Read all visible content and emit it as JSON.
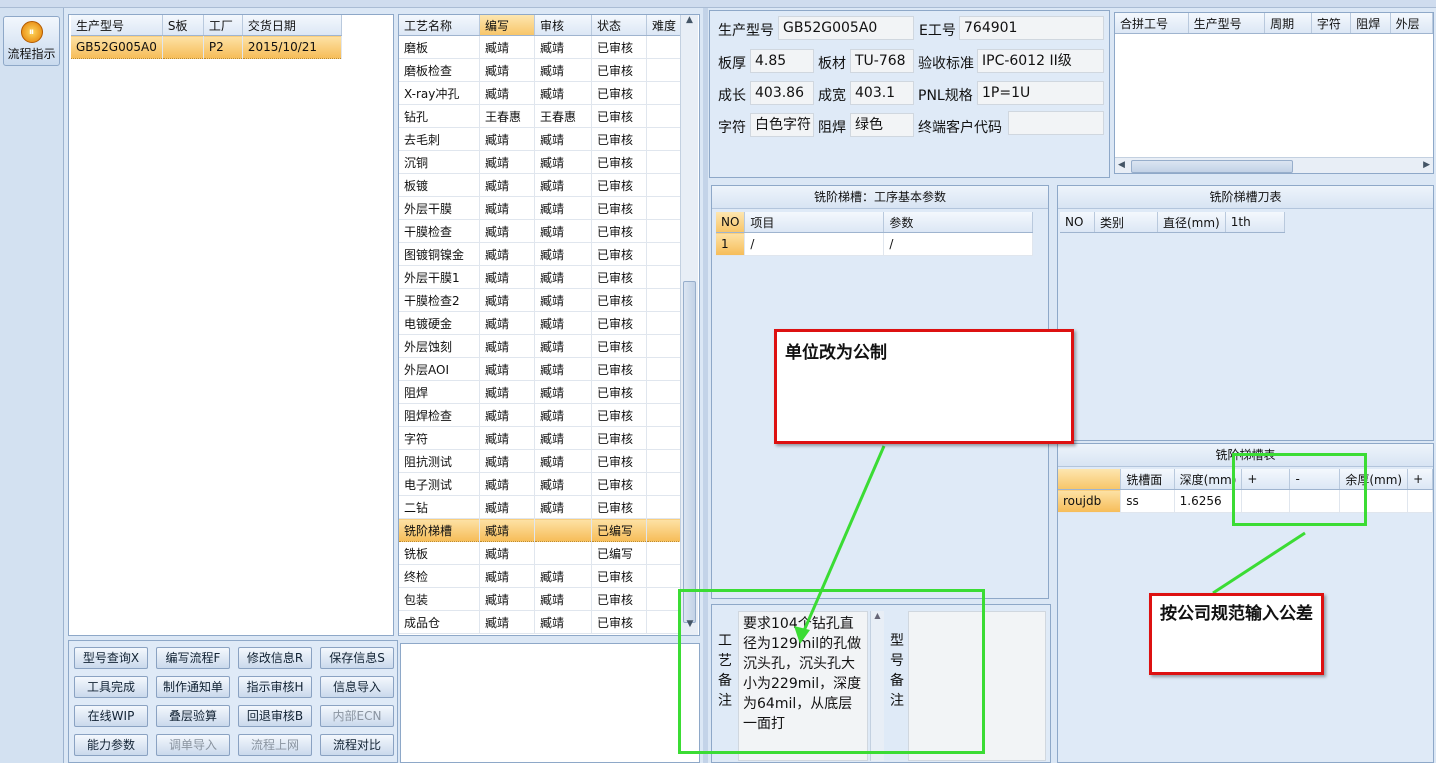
{
  "left_nav": {
    "flow_button_label": "流程指示"
  },
  "model_list": {
    "columns": [
      "生产型号",
      "S板",
      "工厂",
      "交货日期"
    ],
    "rows": [
      [
        "GB52G005A0",
        "",
        "P2",
        "2015/10/21"
      ]
    ]
  },
  "process_grid": {
    "columns": [
      "工艺名称",
      "编写",
      "审核",
      "状态",
      "难度"
    ],
    "rows": [
      [
        "磨板",
        "臧靖",
        "臧靖",
        "已审核",
        ""
      ],
      [
        "磨板检查",
        "臧靖",
        "臧靖",
        "已审核",
        ""
      ],
      [
        "X-ray冲孔",
        "臧靖",
        "臧靖",
        "已审核",
        ""
      ],
      [
        "钻孔",
        "王春惠",
        "王春惠",
        "已审核",
        ""
      ],
      [
        "去毛刺",
        "臧靖",
        "臧靖",
        "已审核",
        ""
      ],
      [
        "沉铜",
        "臧靖",
        "臧靖",
        "已审核",
        ""
      ],
      [
        "板镀",
        "臧靖",
        "臧靖",
        "已审核",
        ""
      ],
      [
        "外层干膜",
        "臧靖",
        "臧靖",
        "已审核",
        ""
      ],
      [
        "干膜检查",
        "臧靖",
        "臧靖",
        "已审核",
        ""
      ],
      [
        "图镀铜镍金",
        "臧靖",
        "臧靖",
        "已审核",
        ""
      ],
      [
        "外层干膜1",
        "臧靖",
        "臧靖",
        "已审核",
        ""
      ],
      [
        "干膜检查2",
        "臧靖",
        "臧靖",
        "已审核",
        ""
      ],
      [
        "电镀硬金",
        "臧靖",
        "臧靖",
        "已审核",
        ""
      ],
      [
        "外层蚀刻",
        "臧靖",
        "臧靖",
        "已审核",
        ""
      ],
      [
        "外层AOI",
        "臧靖",
        "臧靖",
        "已审核",
        ""
      ],
      [
        "阻焊",
        "臧靖",
        "臧靖",
        "已审核",
        ""
      ],
      [
        "阻焊检查",
        "臧靖",
        "臧靖",
        "已审核",
        ""
      ],
      [
        "字符",
        "臧靖",
        "臧靖",
        "已审核",
        ""
      ],
      [
        "阻抗测试",
        "臧靖",
        "臧靖",
        "已审核",
        ""
      ],
      [
        "电子测试",
        "臧靖",
        "臧靖",
        "已审核",
        ""
      ],
      [
        "二钻",
        "臧靖",
        "臧靖",
        "已审核",
        ""
      ],
      [
        "铣阶梯槽",
        "臧靖",
        "",
        "已编写",
        ""
      ],
      [
        "铣板",
        "臧靖",
        "",
        "已编写",
        ""
      ],
      [
        "终检",
        "臧靖",
        "臧靖",
        "已审核",
        ""
      ],
      [
        "包装",
        "臧靖",
        "臧靖",
        "已审核",
        ""
      ],
      [
        "成品仓",
        "臧靖",
        "臧靖",
        "已审核",
        ""
      ]
    ],
    "selected_index": 21
  },
  "buttons": [
    [
      "型号查询X",
      "编写流程F",
      "修改信息R",
      "保存信息S"
    ],
    [
      "工具完成",
      "制作通知单",
      "指示审核H",
      "信息导入"
    ],
    [
      "在线WIP",
      "叠层验算",
      "回退审核B",
      "内部ECN"
    ],
    [
      "能力参数",
      "调单导入",
      "流程上网",
      "流程对比"
    ]
  ],
  "disabled_buttons": [
    "内部ECN",
    "调单导入",
    "流程上网"
  ],
  "info": {
    "model_label": "生产型号",
    "model_value": "GB52G005A0",
    "e_label": "E工号",
    "e_value": "764901",
    "thickness_label": "板厚",
    "thickness_value": "4.85",
    "material_label": "板材",
    "material_value": "TU-768",
    "std_label": "验收标准",
    "std_value": "IPC-6012 II级",
    "length_label": "成长",
    "length_value": "403.86",
    "width_label": "成宽",
    "width_value": "403.1",
    "pnl_label": "PNL规格",
    "pnl_value": "1P=1U",
    "char_label": "字符",
    "char_value": "白色字符",
    "mask_label": "阻焊",
    "mask_value": "绿色",
    "customer_label": "终端客户代码",
    "customer_value": ""
  },
  "merge_table": {
    "columns": [
      "合拼工号",
      "生产型号",
      "周期",
      "字符",
      "阻焊",
      "外层"
    ]
  },
  "params_section": {
    "title": "铣阶梯槽：工序基本参数",
    "columns": [
      "NO",
      "项目",
      "参数"
    ],
    "rows": [
      [
        "1",
        "/",
        "/"
      ]
    ]
  },
  "tool_section": {
    "title": "铣阶梯槽刀表",
    "columns": [
      "NO",
      "类别",
      "直径(mm)",
      "1th"
    ]
  },
  "slot_section": {
    "title": "铣阶梯槽表",
    "columns": [
      "",
      "铣槽面",
      "深度(mm)",
      "+",
      "-",
      "余厚(mm)",
      "+"
    ],
    "rows": [
      [
        "roujdb",
        "ss",
        "1.6256",
        "",
        "",
        "",
        ""
      ]
    ]
  },
  "remarks": {
    "craft_label": "工艺备注",
    "craft_text": "要求104个钻孔直径为129mil的孔做沉头孔，沉头孔大小为229mil，深度为64mil，从底层一面打",
    "model_label": "型号备注",
    "model_text": ""
  },
  "annotations": {
    "unit_note": "单位改为公制",
    "tolerance_note": "按公司规范输入公差"
  }
}
